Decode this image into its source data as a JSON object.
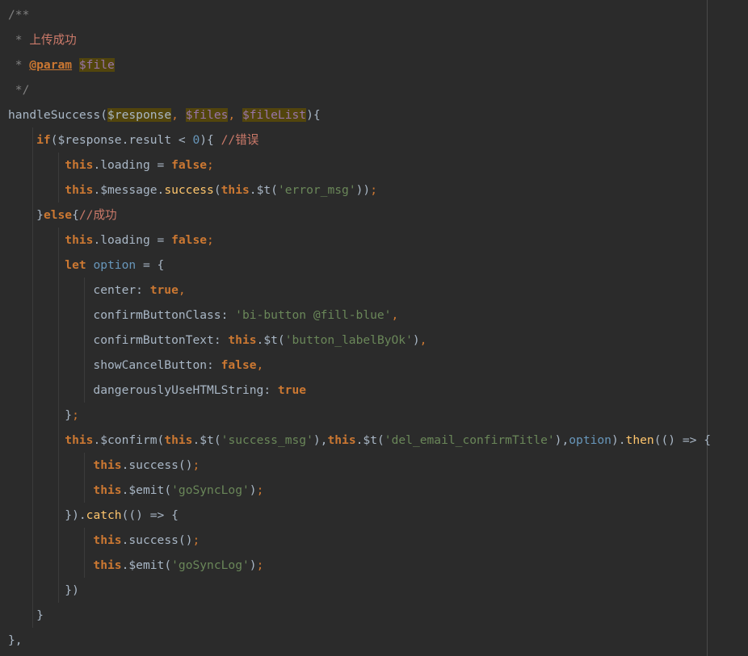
{
  "editor": {
    "lines": [
      [
        {
          "t": "/**",
          "c": "comment"
        }
      ],
      [
        {
          "t": " * ",
          "c": "comment"
        },
        {
          "t": "上传成功",
          "c": "cn"
        }
      ],
      [
        {
          "t": " * ",
          "c": "comment"
        },
        {
          "t": "@param",
          "c": "doctag"
        },
        {
          "t": " ",
          "c": "comment"
        },
        {
          "t": "$file",
          "c": "docvar hl"
        }
      ],
      [
        {
          "t": " */",
          "c": "comment"
        }
      ],
      [
        {
          "t": "handleSuccess",
          "c": "fn"
        },
        {
          "t": "(",
          "c": "punct"
        },
        {
          "t": "$response",
          "c": "param hl"
        },
        {
          "t": ", ",
          "c": "semi"
        },
        {
          "t": "$files",
          "c": "var hl"
        },
        {
          "t": ", ",
          "c": "semi"
        },
        {
          "t": "$fileList",
          "c": "var hl"
        },
        {
          "t": "){",
          "c": "punct"
        }
      ],
      [
        {
          "t": "    if",
          "c": "keyword"
        },
        {
          "t": "(",
          "c": "punct"
        },
        {
          "t": "$response",
          "c": "param"
        },
        {
          "t": ".",
          "c": "punct"
        },
        {
          "t": "result",
          "c": "prop"
        },
        {
          "t": " < ",
          "c": "op"
        },
        {
          "t": "0",
          "c": "num"
        },
        {
          "t": "){ ",
          "c": "punct"
        },
        {
          "t": "//错误",
          "c": "cn"
        }
      ],
      [
        {
          "t": "        this",
          "c": "keyword"
        },
        {
          "t": ".",
          "c": "punct"
        },
        {
          "t": "loading",
          "c": "prop"
        },
        {
          "t": " = ",
          "c": "op"
        },
        {
          "t": "false",
          "c": "keyword"
        },
        {
          "t": ";",
          "c": "semi"
        }
      ],
      [
        {
          "t": "        this",
          "c": "keyword"
        },
        {
          "t": ".",
          "c": "punct"
        },
        {
          "t": "$message",
          "c": "prop"
        },
        {
          "t": ".",
          "c": "punct"
        },
        {
          "t": "success",
          "c": "method"
        },
        {
          "t": "(",
          "c": "punct"
        },
        {
          "t": "this",
          "c": "keyword"
        },
        {
          "t": ".",
          "c": "punct"
        },
        {
          "t": "$t",
          "c": "prop"
        },
        {
          "t": "(",
          "c": "punct"
        },
        {
          "t": "'error_msg'",
          "c": "str"
        },
        {
          "t": "))",
          "c": "punct"
        },
        {
          "t": ";",
          "c": "semi"
        }
      ],
      [
        {
          "t": "    }",
          "c": "punct"
        },
        {
          "t": "else",
          "c": "keyword"
        },
        {
          "t": "{",
          "c": "punct"
        },
        {
          "t": "//成功",
          "c": "cn"
        }
      ],
      [
        {
          "t": "        this",
          "c": "keyword"
        },
        {
          "t": ".",
          "c": "punct"
        },
        {
          "t": "loading",
          "c": "prop"
        },
        {
          "t": " = ",
          "c": "op"
        },
        {
          "t": "false",
          "c": "keyword"
        },
        {
          "t": ";",
          "c": "semi"
        }
      ],
      [
        {
          "t": "        let ",
          "c": "keyword"
        },
        {
          "t": "option",
          "c": "localvar"
        },
        {
          "t": " = {",
          "c": "op"
        }
      ],
      [
        {
          "t": "            center",
          "c": "prop"
        },
        {
          "t": ": ",
          "c": "punct"
        },
        {
          "t": "true",
          "c": "keyword"
        },
        {
          "t": ",",
          "c": "semi"
        }
      ],
      [
        {
          "t": "            confirmButtonClass",
          "c": "prop"
        },
        {
          "t": ": ",
          "c": "punct"
        },
        {
          "t": "'bi-button @fill-blue'",
          "c": "str"
        },
        {
          "t": ",",
          "c": "semi"
        }
      ],
      [
        {
          "t": "            confirmButtonText",
          "c": "prop"
        },
        {
          "t": ": ",
          "c": "punct"
        },
        {
          "t": "this",
          "c": "keyword"
        },
        {
          "t": ".",
          "c": "punct"
        },
        {
          "t": "$t",
          "c": "prop"
        },
        {
          "t": "(",
          "c": "punct"
        },
        {
          "t": "'button_labelByOk'",
          "c": "str"
        },
        {
          "t": ")",
          "c": "punct"
        },
        {
          "t": ",",
          "c": "semi"
        }
      ],
      [
        {
          "t": "            showCancelButton",
          "c": "prop"
        },
        {
          "t": ": ",
          "c": "punct"
        },
        {
          "t": "false",
          "c": "keyword"
        },
        {
          "t": ",",
          "c": "semi"
        }
      ],
      [
        {
          "t": "            dangerouslyUseHTMLString",
          "c": "prop"
        },
        {
          "t": ": ",
          "c": "punct"
        },
        {
          "t": "true",
          "c": "keyword"
        }
      ],
      [
        {
          "t": "        }",
          "c": "punct"
        },
        {
          "t": ";",
          "c": "semi"
        }
      ],
      [
        {
          "t": "        this",
          "c": "keyword"
        },
        {
          "t": ".",
          "c": "punct"
        },
        {
          "t": "$confirm",
          "c": "prop"
        },
        {
          "t": "(",
          "c": "punct"
        },
        {
          "t": "this",
          "c": "keyword"
        },
        {
          "t": ".",
          "c": "punct"
        },
        {
          "t": "$t",
          "c": "prop"
        },
        {
          "t": "(",
          "c": "punct"
        },
        {
          "t": "'success_msg'",
          "c": "str"
        },
        {
          "t": "),",
          "c": "punct"
        },
        {
          "t": "this",
          "c": "keyword"
        },
        {
          "t": ".",
          "c": "punct"
        },
        {
          "t": "$t",
          "c": "prop"
        },
        {
          "t": "(",
          "c": "punct"
        },
        {
          "t": "'del_email_confirmTitle'",
          "c": "str"
        },
        {
          "t": "),",
          "c": "punct"
        },
        {
          "t": "option",
          "c": "localvar"
        },
        {
          "t": ").",
          "c": "punct"
        },
        {
          "t": "then",
          "c": "method"
        },
        {
          "t": "(() => {",
          "c": "punct"
        }
      ],
      [
        {
          "t": "            this",
          "c": "keyword"
        },
        {
          "t": ".",
          "c": "punct"
        },
        {
          "t": "success",
          "c": "prop"
        },
        {
          "t": "()",
          "c": "punct"
        },
        {
          "t": ";",
          "c": "semi"
        }
      ],
      [
        {
          "t": "            this",
          "c": "keyword"
        },
        {
          "t": ".",
          "c": "punct"
        },
        {
          "t": "$emit",
          "c": "prop"
        },
        {
          "t": "(",
          "c": "punct"
        },
        {
          "t": "'goSyncLog'",
          "c": "str"
        },
        {
          "t": ")",
          "c": "punct"
        },
        {
          "t": ";",
          "c": "semi"
        }
      ],
      [
        {
          "t": "        }).",
          "c": "punct"
        },
        {
          "t": "catch",
          "c": "method"
        },
        {
          "t": "(() => {",
          "c": "punct"
        }
      ],
      [
        {
          "t": "            this",
          "c": "keyword"
        },
        {
          "t": ".",
          "c": "punct"
        },
        {
          "t": "success",
          "c": "prop"
        },
        {
          "t": "()",
          "c": "punct"
        },
        {
          "t": ";",
          "c": "semi"
        }
      ],
      [
        {
          "t": "            this",
          "c": "keyword"
        },
        {
          "t": ".",
          "c": "punct"
        },
        {
          "t": "$emit",
          "c": "prop"
        },
        {
          "t": "(",
          "c": "punct"
        },
        {
          "t": "'goSyncLog'",
          "c": "str"
        },
        {
          "t": ")",
          "c": "punct"
        },
        {
          "t": ";",
          "c": "semi"
        }
      ],
      [
        {
          "t": "        })",
          "c": "punct"
        }
      ],
      [
        {
          "t": "    }",
          "c": "punct"
        }
      ],
      [
        {
          "t": "},",
          "c": "punct"
        }
      ]
    ]
  },
  "colors": {
    "background": "#2b2b2b",
    "keyword": "#cc7832",
    "string": "#6a8759",
    "comment": "#808080",
    "chinese_comment": "#cc7a6a",
    "local_variable": "#6897bb",
    "method": "#ffc66d",
    "parameter_highlight": "#52450d"
  }
}
